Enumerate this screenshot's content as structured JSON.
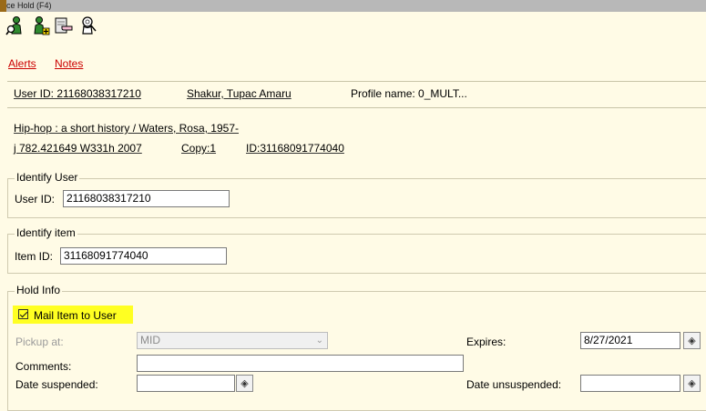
{
  "window": {
    "title": "ce Hold (F4)"
  },
  "toolbar": {
    "icons": [
      "user-search-icon",
      "add-user-icon",
      "point-at-hand-icon",
      "magnifying-user-icon"
    ]
  },
  "links": {
    "alerts": "Alerts",
    "notes": "Notes"
  },
  "user_header": {
    "user_id_text": "User ID: 21168038317210",
    "user_name": "Shakur, Tupac Amaru",
    "profile_text": "Profile name: 0_MULT..."
  },
  "item_header": {
    "title_line": "Hip-hop : a short history / Waters, Rosa, 1957-",
    "call_number": "j 782.421649 W331h 2007",
    "copy": "Copy:1",
    "id_text": "ID:31168091774040"
  },
  "identify_user": {
    "legend": "Identify User",
    "label": "User ID:",
    "value": "21168038317210"
  },
  "identify_item": {
    "legend": "Identify item",
    "label": "Item ID:",
    "value": "31168091774040"
  },
  "hold_info": {
    "legend": "Hold Info",
    "mail_label": "Mail Item to User",
    "mail_checked": true,
    "pickup_label": "Pickup at:",
    "pickup_value": "MID",
    "expires_label": "Expires:",
    "expires_value": "8/27/2021",
    "comments_label": "Comments:",
    "comments_value": "",
    "date_suspended_label": "Date suspended:",
    "date_suspended_value": "",
    "date_unsuspended_label": "Date unsuspended:",
    "date_unsuspended_value": ""
  },
  "colors": {
    "background": "#fffbe6",
    "link": "#cc0000",
    "highlight": "#ffff22",
    "titlebar": "#b8b8b8"
  }
}
